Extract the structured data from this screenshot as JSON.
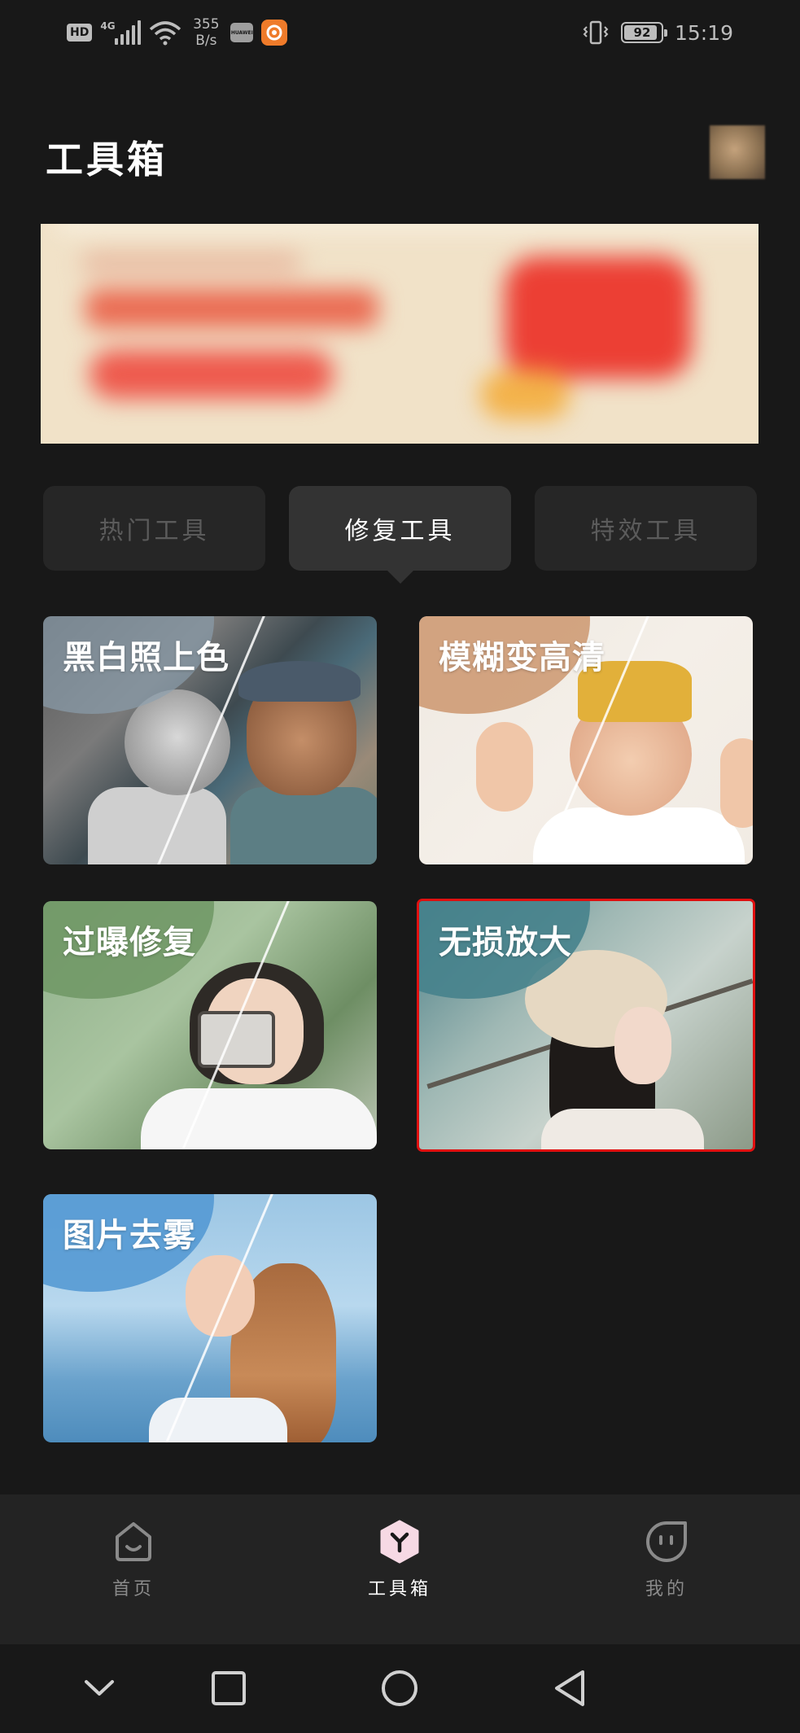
{
  "status_bar": {
    "hd": "HD",
    "network": "4G",
    "speed_value": "355",
    "speed_unit": "B/s",
    "app_badge": "HUAWEI",
    "battery": "92",
    "battery_level": 0.92,
    "time": "15:19"
  },
  "header": {
    "title": "工具箱"
  },
  "tabs": [
    {
      "label": "热门工具",
      "active": false
    },
    {
      "label": "修复工具",
      "active": true
    },
    {
      "label": "特效工具",
      "active": false
    }
  ],
  "tools": [
    {
      "label": "黑白照上色",
      "selected": false
    },
    {
      "label": "模糊变高清",
      "selected": false
    },
    {
      "label": "过曝修复",
      "selected": false
    },
    {
      "label": "无损放大",
      "selected": true
    },
    {
      "label": "图片去雾",
      "selected": false
    }
  ],
  "bottom_nav": [
    {
      "label": "首页",
      "icon": "home-icon",
      "active": false
    },
    {
      "label": "工具箱",
      "icon": "toolbox-icon",
      "active": true
    },
    {
      "label": "我的",
      "icon": "profile-icon",
      "active": false
    }
  ],
  "system_nav": [
    "chevron-down-icon",
    "recents-square-icon",
    "home-circle-icon",
    "back-triangle-icon"
  ],
  "colors": {
    "background": "#181818",
    "tab_inactive_bg": "#262626",
    "tab_active_bg": "#333333",
    "nav_bg": "#232323",
    "selection_outline": "#e01010"
  }
}
